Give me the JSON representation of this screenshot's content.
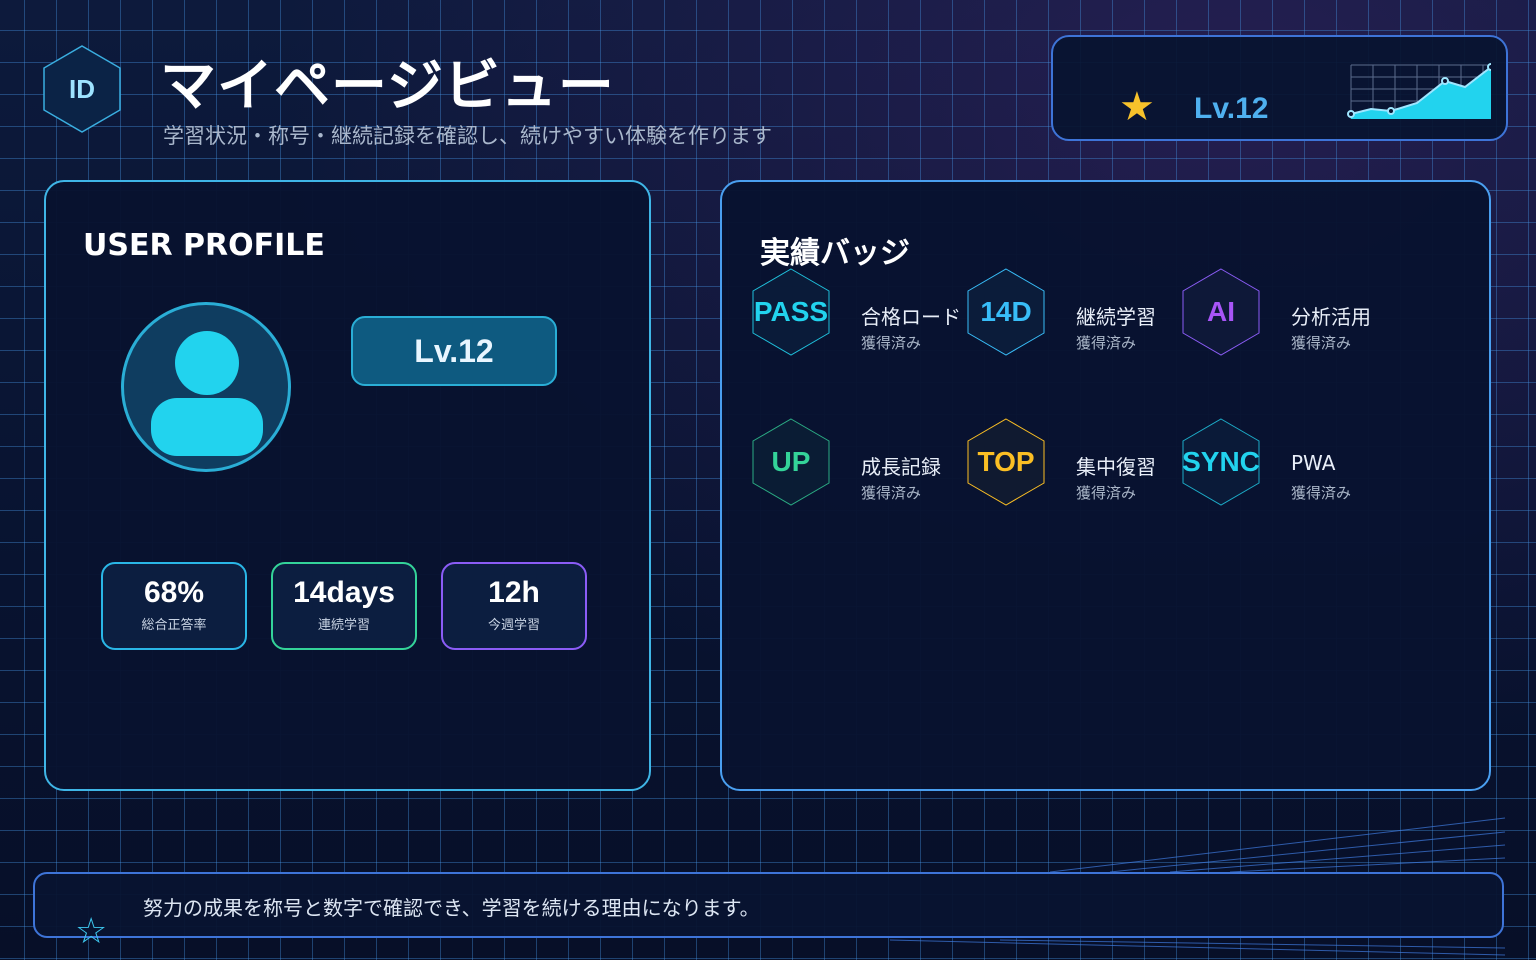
{
  "header": {
    "id_badge": "ID",
    "title": "マイページビュー",
    "subtitle": "学習状況・称号・継続記録を確認し、続けやすい体験を作ります"
  },
  "level_card": {
    "star_icon": "star-icon",
    "level": "Lv.12"
  },
  "profile": {
    "heading": "USER PROFILE",
    "avatar_icon": "user-icon",
    "level": "Lv.12",
    "stats": [
      {
        "value": "68%",
        "label": "総合正答率",
        "color": "#2ab6e6"
      },
      {
        "value": "14days",
        "label": "連続学習",
        "color": "#34d399"
      },
      {
        "value": "12h",
        "label": "今週学習",
        "color": "#8b5cf6"
      }
    ]
  },
  "badges": {
    "heading": "実績バッジ",
    "items": [
      {
        "code": "PASS",
        "name": "合格ロード",
        "state": "獲得済み",
        "color": "#22d3ee"
      },
      {
        "code": "14D",
        "name": "継続学習",
        "state": "獲得済み",
        "color": "#38bdf8"
      },
      {
        "code": "AI",
        "name": "分析活用",
        "state": "獲得済み",
        "color": "#a855f7"
      },
      {
        "code": "UP",
        "name": "成長記録",
        "state": "獲得済み",
        "color": "#34d399"
      },
      {
        "code": "TOP",
        "name": "集中復習",
        "state": "獲得済み",
        "color": "#fbbf24"
      },
      {
        "code": "SYNC",
        "name": "PWA",
        "state": "獲得済み",
        "color": "#22d3ee"
      }
    ]
  },
  "footer": {
    "icon": "star-outline-icon",
    "text": "努力の成果を称号と数字で確認でき、学習を続ける理由になります。"
  }
}
